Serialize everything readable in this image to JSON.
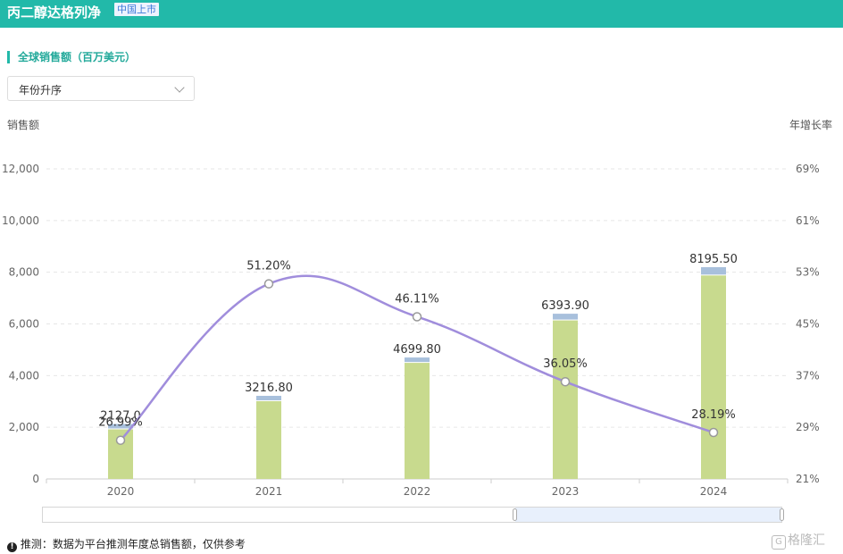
{
  "header": {
    "title": "丙二醇达格列净",
    "badge": "中国上市"
  },
  "section": {
    "title": "全球销售额（百万美元）"
  },
  "sort_select": {
    "value": "年份升序"
  },
  "colors": {
    "bar_main": "#c8da8e",
    "bar_top": "#a8c0dc",
    "line": "#a08ddc",
    "grid": "#e6e6e6",
    "accent": "#22b9a9"
  },
  "chart_data": {
    "type": "bar",
    "categories": [
      "2020",
      "2021",
      "2022",
      "2023",
      "2024"
    ],
    "series": [
      {
        "values": [
          2127.0,
          3216.8,
          4699.8,
          6393.9,
          8195.5
        ]
      },
      {
        "axis": "right",
        "type": "line",
        "values": [
          26.99,
          51.2,
          46.11,
          36.05,
          28.19
        ]
      }
    ],
    "value_labels": [
      "2127.0",
      "3216.80",
      "4699.80",
      "6393.90",
      "8195.50"
    ],
    "growth_labels": [
      "26.99%",
      "51.20%",
      "46.11%",
      "36.05%",
      "28.19%"
    ],
    "ylabel": "销售额",
    "ylabel_right": "年增长率",
    "ylim": [
      0,
      12000
    ],
    "yticks": [
      "0",
      "2,000",
      "4,000",
      "6,000",
      "8,000",
      "10,000",
      "12,000"
    ],
    "ylim_right": [
      21,
      69
    ],
    "yticks_right": [
      "21%",
      "29%",
      "37%",
      "45%",
      "53%",
      "61%",
      "69%"
    ],
    "grid": true
  },
  "footer": {
    "info_icon": "info-icon",
    "note": "推测：数据为平台推测年度总销售额，仅供参考",
    "watermark": "格隆汇"
  }
}
